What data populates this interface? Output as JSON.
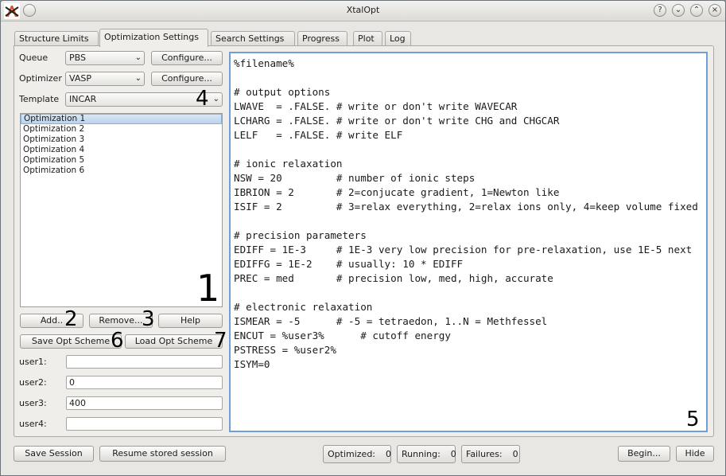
{
  "window": {
    "title": "XtalOpt"
  },
  "titlebar_icons": [
    "help-icon",
    "chevron-down-icon",
    "chevron-up-icon",
    "close-icon"
  ],
  "tabs": [
    {
      "label": "Structure Limits",
      "accel": "S"
    },
    {
      "label": "Optimization Settings",
      "active": true
    },
    {
      "label": "Search Settings"
    },
    {
      "label": "Progress"
    },
    {
      "label": "Plot"
    },
    {
      "label": "Log"
    }
  ],
  "settings": {
    "queue_label": "Queue",
    "queue_value": "PBS",
    "optimizer_label": "Optimizer",
    "optimizer_value": "VASP",
    "template_label": "Template",
    "template_value": "INCAR",
    "configure_label": "Configure..."
  },
  "optimizations": [
    "Optimization 1",
    "Optimization 2",
    "Optimization 3",
    "Optimization 4",
    "Optimization 5",
    "Optimization 6"
  ],
  "buttons": {
    "add": "Add..",
    "remove": "Remove...",
    "help": "Help",
    "save_scheme": "Save Opt Scheme",
    "load_scheme": "Load Opt Scheme"
  },
  "user_fields": [
    {
      "label": "user1:",
      "value": ""
    },
    {
      "label": "user2:",
      "value": "0"
    },
    {
      "label": "user3:",
      "value": "400"
    },
    {
      "label": "user4:",
      "value": ""
    }
  ],
  "template_text": "%filename%\n\n# output options\nLWAVE  = .FALSE. # write or don't write WAVECAR\nLCHARG = .FALSE. # write or don't write CHG and CHGCAR\nLELF   = .FALSE. # write ELF\n\n# ionic relaxation\nNSW = 20         # number of ionic steps\nIBRION = 2       # 2=conjucate gradient, 1=Newton like\nISIF = 2         # 3=relax everything, 2=relax ions only, 4=keep volume fixed\n\n# precision parameters\nEDIFF = 1E-3     # 1E-3 very low precision for pre-relaxation, use 1E-5 next\nEDIFFG = 1E-2    # usually: 10 * EDIFF\nPREC = med       # precision low, med, high, accurate\n\n# electronic relaxation\nISMEAR = -5      # -5 = tetraedon, 1..N = Methfessel\nENCUT = %user3%      # cutoff energy\nPSTRESS = %user2%\nISYM=0",
  "markers": [
    "1",
    "2",
    "3",
    "4",
    "5",
    "6",
    "7"
  ],
  "bottom": {
    "save_session": "Save Session",
    "resume_session": "Resume stored session",
    "optimized_label": "Optimized:",
    "optimized_value": "0",
    "running_label": "Running:",
    "running_value": "0",
    "failures_label": "Failures:",
    "failures_value": "0",
    "begin": "Begin...",
    "hide": "Hide"
  }
}
